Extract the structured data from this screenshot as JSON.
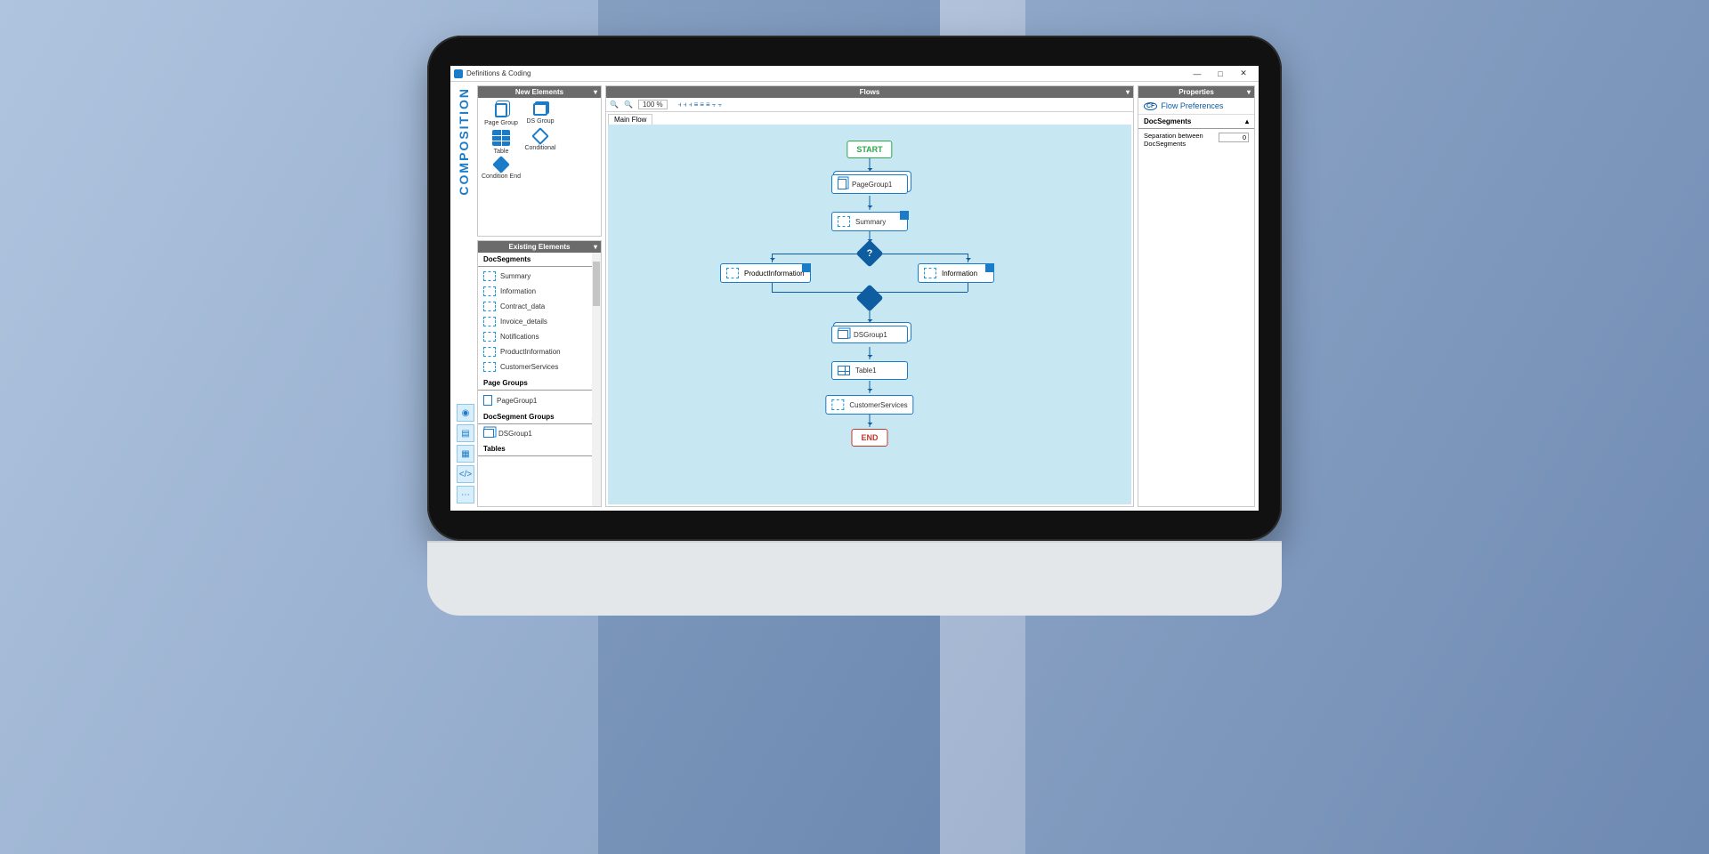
{
  "window": {
    "title": "Definitions & Coding",
    "minimize": "—",
    "maximize": "□",
    "close": "✕"
  },
  "sidebar_label": "COMPOSITION",
  "panels": {
    "new_elements": {
      "title": "New Elements"
    },
    "existing_elements": {
      "title": "Existing Elements"
    },
    "flows": {
      "title": "Flows"
    },
    "properties": {
      "title": "Properties"
    }
  },
  "new_elements": [
    {
      "label": "Page Group",
      "kind": "page"
    },
    {
      "label": "DS Group",
      "kind": "ds"
    },
    {
      "label": "Table",
      "kind": "table"
    },
    {
      "label": "Conditional",
      "kind": "cond"
    },
    {
      "label": "Condition End",
      "kind": "condend"
    }
  ],
  "existing": {
    "sections": {
      "docsegments": "DocSegments",
      "pagegroups": "Page Groups",
      "dsgroups": "DocSegment Groups",
      "tables": "Tables"
    },
    "docsegments": [
      "Summary",
      "Information",
      "Contract_data",
      "Invoice_details",
      "Notifications",
      "ProductInformation",
      "CustomerServices"
    ],
    "pagegroups": [
      "PageGroup1"
    ],
    "dsgroups": [
      "DSGroup1"
    ]
  },
  "flows": {
    "zoom": "100 %",
    "tab": "Main Flow",
    "start": "START",
    "end": "END",
    "nodes": {
      "pagegroup": "PageGroup1",
      "summary": "Summary",
      "productinfo": "ProductInformation",
      "information": "Information",
      "dsgroup": "DSGroup1",
      "table": "Table1",
      "custserv": "CustomerServices"
    }
  },
  "properties": {
    "flow_pref": "Flow Preferences",
    "section": "DocSegments",
    "separation_label": "Separation between DocSegments",
    "separation_value": "0"
  },
  "toolrail": [
    "◉",
    "▤",
    "▦",
    "</>",
    "⋯"
  ]
}
